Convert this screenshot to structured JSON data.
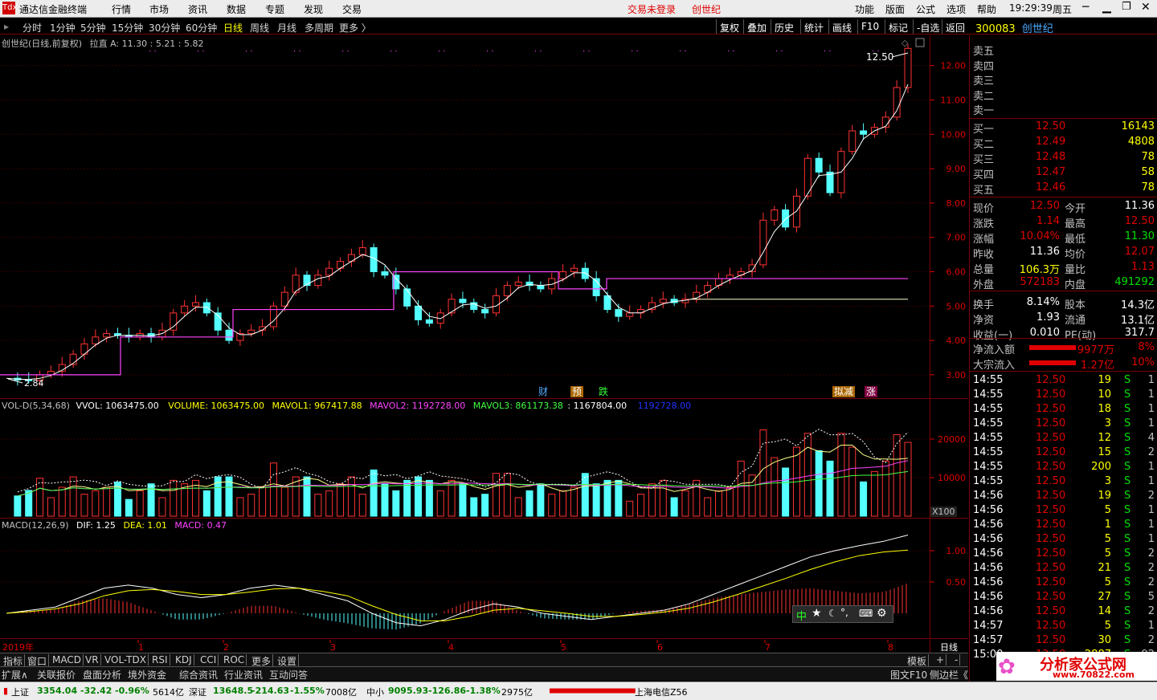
{
  "app": {
    "title": "通达信金融终端"
  },
  "menu": {
    "items": [
      "行情",
      "市场",
      "资讯",
      "数据",
      "专题",
      "发现",
      "交易"
    ],
    "status_login": "交易未登录",
    "status_stock": "创世纪",
    "right_items": [
      "功能",
      "版面",
      "公式",
      "选项",
      "帮助"
    ],
    "time": "19:29:39",
    "weekday": "周五"
  },
  "periods": {
    "items": [
      "分时",
      "1分钟",
      "5分钟",
      "15分钟",
      "30分钟",
      "60分钟",
      "日线",
      "周线",
      "月线",
      "多周期",
      "更多 〉"
    ],
    "selected": "日线",
    "tools": [
      "复权",
      "叠加",
      "历史",
      "统计",
      "画线",
      "F10",
      "标记",
      "-自选",
      "返回"
    ]
  },
  "quote_header": {
    "code": "300083",
    "name": "创世纪"
  },
  "main_chart": {
    "legend": "创世纪(日线,前复权)",
    "legend2": "拉直  A: 11.30 : 5.21 : 5.82",
    "high_label": "12.50",
    "low_label": "2.84",
    "event_labels": [
      "财",
      "预",
      "跌",
      "拟减",
      "涨"
    ]
  },
  "volume_panel": {
    "legend": "VOL-D(5,34,68)",
    "vvol": "VVOL: 1063475.00",
    "volume": "VOLUME: 1063475.00",
    "mavol1": "MAVOL1: 967417.88",
    "mavol2": "MAVOL2: 1192728.00",
    "mavol3": "MAVOL3: 861173.38",
    "extra1": ": 1167804.00",
    "extra2": "1192728.00",
    "unit": "X100"
  },
  "macd_panel": {
    "legend": "MACD(12,26,9)",
    "dif": "DIF: 1.25",
    "dea": "DEA: 1.01",
    "macd": "MACD: 0.47"
  },
  "date_axis": {
    "year": "2019年",
    "months": [
      "1",
      "2",
      "3",
      "4",
      "5",
      "6",
      "7",
      "8"
    ],
    "period": "日线"
  },
  "bottom_tabs": {
    "row1": [
      "指标",
      "窗口",
      "MACD",
      "VR",
      "VOL-TDX",
      "RSI",
      "KDJ",
      "CCI",
      "ROC",
      "更多",
      "设置"
    ],
    "row2": [
      "扩展∧",
      "关联报价",
      "盘面分析",
      "境外资金",
      "综合资讯",
      "行业资讯",
      "互动问答"
    ],
    "right1": [
      "模板",
      "+",
      "-"
    ],
    "right2": [
      "图文F10",
      "侧边栏《",
      "笔"
    ]
  },
  "order_book": {
    "sell": [
      {
        "label": "卖五",
        "price": "",
        "vol": ""
      },
      {
        "label": "卖四",
        "price": "",
        "vol": ""
      },
      {
        "label": "卖三",
        "price": "",
        "vol": ""
      },
      {
        "label": "卖二",
        "price": "",
        "vol": ""
      },
      {
        "label": "卖一",
        "price": "",
        "vol": ""
      }
    ],
    "buy": [
      {
        "label": "买一",
        "price": "12.50",
        "vol": "16143"
      },
      {
        "label": "买二",
        "price": "12.49",
        "vol": "4808"
      },
      {
        "label": "买三",
        "price": "12.48",
        "vol": "78"
      },
      {
        "label": "买四",
        "price": "12.47",
        "vol": "58"
      },
      {
        "label": "买五",
        "price": "12.46",
        "vol": "78"
      }
    ]
  },
  "stats": [
    {
      "l1": "现价",
      "v1": "12.50",
      "l2": "今开",
      "v2": "11.36"
    },
    {
      "l1": "涨跌",
      "v1": "1.14",
      "l2": "最高",
      "v2": "12.50"
    },
    {
      "l1": "涨幅",
      "v1": "10.04%",
      "l2": "最低",
      "v2": "11.30"
    },
    {
      "l1": "昨收",
      "v1": "11.36",
      "l2": "均价",
      "v2": "12.07"
    },
    {
      "l1": "总量",
      "v1": "106.3万",
      "l2": "量比",
      "v2": "1.13"
    },
    {
      "l1": "外盘",
      "v1": "572183",
      "l2": "内盘",
      "v2": "491292"
    },
    {
      "l1": "换手",
      "v1": "8.14%",
      "l2": "股本",
      "v2": "14.3亿"
    },
    {
      "l1": "净资",
      "v1": "1.93",
      "l2": "流通",
      "v2": "13.1亿"
    },
    {
      "l1": "收益(一)",
      "v1": "0.010",
      "l2": "PE(动)",
      "v2": "317.7"
    }
  ],
  "flows": [
    {
      "label": "净流入额",
      "value": "9977万",
      "pct": "8%"
    },
    {
      "label": "大宗流入",
      "value": "1.27亿",
      "pct": "10%"
    }
  ],
  "ticks": [
    {
      "t": "14:55",
      "p": "12.50",
      "v": "19",
      "s": "S",
      "n": "1"
    },
    {
      "t": "14:55",
      "p": "12.50",
      "v": "10",
      "s": "S",
      "n": "1"
    },
    {
      "t": "14:55",
      "p": "12.50",
      "v": "18",
      "s": "S",
      "n": "1"
    },
    {
      "t": "14:55",
      "p": "12.50",
      "v": "3",
      "s": "S",
      "n": "1"
    },
    {
      "t": "14:55",
      "p": "12.50",
      "v": "12",
      "s": "S",
      "n": "4"
    },
    {
      "t": "14:55",
      "p": "12.50",
      "v": "15",
      "s": "S",
      "n": "2"
    },
    {
      "t": "14:55",
      "p": "12.50",
      "v": "200",
      "s": "S",
      "n": "1"
    },
    {
      "t": "14:55",
      "p": "12.50",
      "v": "3",
      "s": "S",
      "n": "1"
    },
    {
      "t": "14:56",
      "p": "12.50",
      "v": "19",
      "s": "S",
      "n": "2"
    },
    {
      "t": "14:56",
      "p": "12.50",
      "v": "5",
      "s": "S",
      "n": "1"
    },
    {
      "t": "14:56",
      "p": "12.50",
      "v": "1",
      "s": "S",
      "n": "1"
    },
    {
      "t": "14:56",
      "p": "12.50",
      "v": "5",
      "s": "S",
      "n": "1"
    },
    {
      "t": "14:56",
      "p": "12.50",
      "v": "5",
      "s": "S",
      "n": "2"
    },
    {
      "t": "14:56",
      "p": "12.50",
      "v": "21",
      "s": "S",
      "n": "2"
    },
    {
      "t": "14:56",
      "p": "12.50",
      "v": "5",
      "s": "S",
      "n": "2"
    },
    {
      "t": "14:56",
      "p": "12.50",
      "v": "27",
      "s": "S",
      "n": "5"
    },
    {
      "t": "14:56",
      "p": "12.50",
      "v": "14",
      "s": "S",
      "n": "2"
    },
    {
      "t": "14:57",
      "p": "12.50",
      "v": "5",
      "s": "S",
      "n": "1"
    },
    {
      "t": "14:57",
      "p": "12.50",
      "v": "30",
      "s": "S",
      "n": "2"
    },
    {
      "t": "15:00",
      "p": "12.50",
      "v": "2887",
      "s": "S",
      "n": "92"
    }
  ],
  "index_bar": [
    {
      "name": "上证",
      "val": "3354.04",
      "chg": "-32.42",
      "pct": "-0.96%",
      "amt": "5614亿"
    },
    {
      "name": "深证",
      "val": "13648.5",
      "chg": "-214.63",
      "pct": "-1.55%",
      "amt": "7008亿"
    },
    {
      "name": "中小",
      "val": "9095.93",
      "chg": "-126.86",
      "pct": "-1.38%",
      "amt": "2975亿"
    }
  ],
  "server": "上海电信Z56",
  "watermark": {
    "text": "分析家公式网",
    "url": "www.70822.com"
  },
  "chart_data": {
    "type": "candlestick",
    "title": "创世纪(日线,前复权)",
    "price_axis": {
      "ticks": [
        3.0,
        4.0,
        5.0,
        6.0,
        7.0,
        8.0,
        9.0,
        10.0,
        11.0,
        12.0
      ],
      "range": [
        2.6,
        12.6
      ]
    },
    "volume_axis": {
      "ticks": [
        10000,
        20000
      ],
      "unit": "X100"
    },
    "macd_axis": {
      "ticks": [
        0.5,
        1.0
      ]
    },
    "close_path": [
      2.9,
      2.85,
      2.84,
      3.0,
      3.1,
      3.3,
      3.6,
      3.9,
      4.1,
      4.2,
      4.15,
      4.1,
      4.2,
      4.1,
      4.3,
      4.8,
      5.0,
      5.1,
      4.8,
      4.3,
      4.0,
      4.2,
      4.3,
      4.4,
      5.0,
      5.4,
      5.9,
      5.6,
      5.9,
      6.1,
      6.3,
      6.5,
      6.7,
      6.0,
      5.9,
      5.5,
      5.0,
      4.6,
      4.5,
      4.8,
      5.2,
      5.1,
      4.9,
      4.8,
      5.3,
      5.6,
      5.7,
      5.6,
      5.5,
      5.8,
      6.0,
      6.1,
      5.8,
      5.3,
      4.9,
      4.7,
      4.8,
      4.9,
      5.1,
      5.2,
      5.1,
      5.2,
      5.4,
      5.6,
      5.8,
      5.9,
      6.0,
      6.2,
      7.5,
      7.8,
      7.3,
      8.2,
      9.3,
      8.9,
      8.3,
      9.5,
      10.1,
      10.0,
      10.2,
      10.5,
      11.36,
      12.5
    ],
    "macd_dif": [
      0.0,
      0.05,
      0.1,
      0.25,
      0.4,
      0.45,
      0.4,
      0.3,
      0.25,
      0.3,
      0.4,
      0.45,
      0.4,
      0.3,
      0.2,
      0.0,
      -0.15,
      -0.2,
      -0.1,
      0.05,
      0.15,
      0.1,
      0.0,
      -0.05,
      -0.1,
      -0.05,
      0.0,
      0.05,
      0.15,
      0.3,
      0.45,
      0.6,
      0.75,
      0.9,
      1.0,
      1.08,
      1.15,
      1.25
    ],
    "macd_dea": [
      0.0,
      0.03,
      0.07,
      0.15,
      0.28,
      0.36,
      0.38,
      0.35,
      0.3,
      0.3,
      0.34,
      0.39,
      0.4,
      0.35,
      0.28,
      0.12,
      -0.02,
      -0.12,
      -0.12,
      -0.05,
      0.05,
      0.08,
      0.04,
      0.0,
      -0.05,
      -0.05,
      -0.02,
      0.02,
      0.08,
      0.18,
      0.3,
      0.43,
      0.56,
      0.7,
      0.82,
      0.92,
      0.98,
      1.01
    ]
  }
}
